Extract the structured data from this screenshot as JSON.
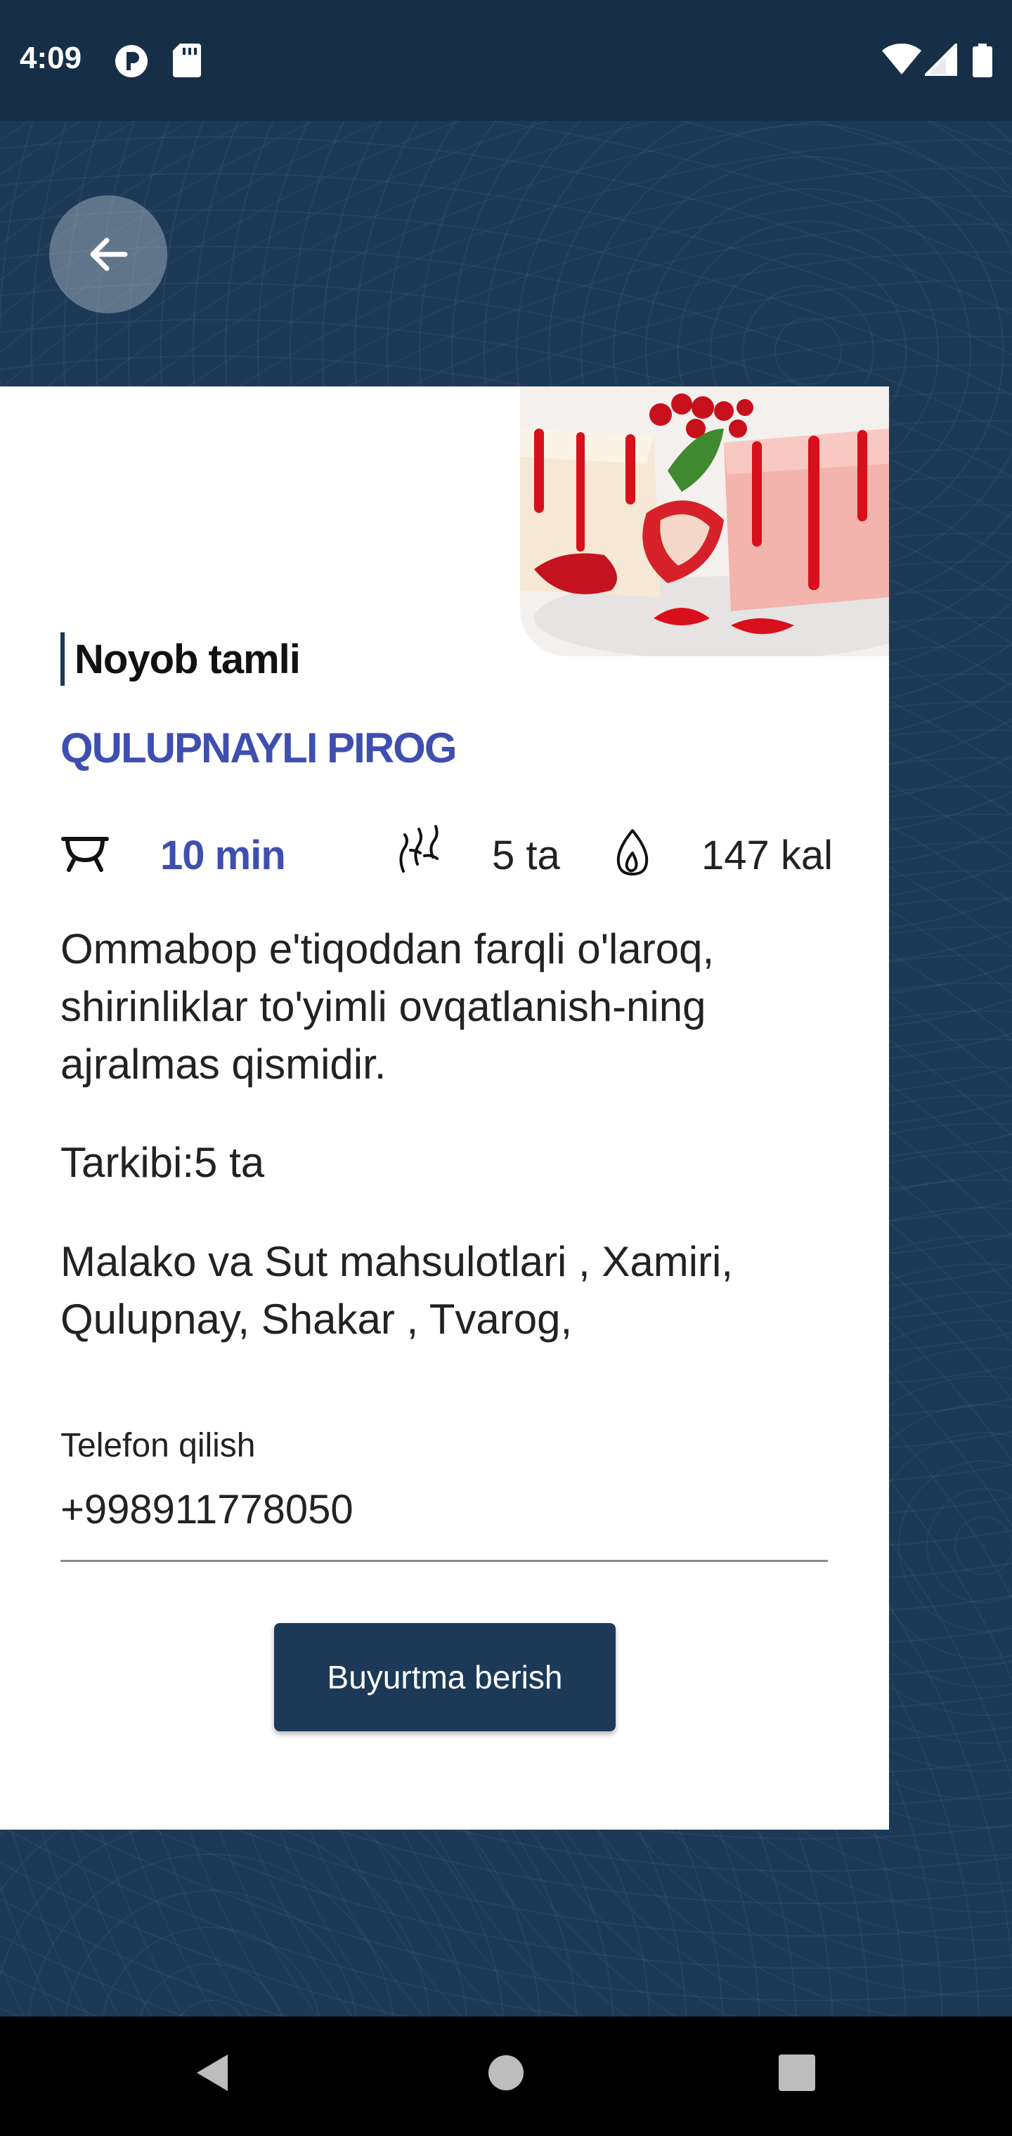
{
  "status_bar": {
    "time": "4:09"
  },
  "recipe": {
    "tagline": "Noyob tamli",
    "title": "QULUPNAYLI PIROG",
    "time": "10 min",
    "servings": "5 ta",
    "calories": "147 kal",
    "description": "Ommabop e'tiqoddan farqli o'laroq, shirinliklar to'yimli ovqatlanish-ning ajralmas qismidir.",
    "ingredients_count": "Tarkibi:5 ta",
    "ingredients": "Malako va Sut mahsulotlari , Xamiri, Qulupnay, Shakar , Tvarog,"
  },
  "order_form": {
    "phone_label": "Telefon qilish",
    "phone_value": "+998911778050",
    "order_button": "Buyurtma berish"
  },
  "colors": {
    "background": "#1c3a58",
    "accent": "#3e4fb0",
    "button": "#1c3a58"
  }
}
